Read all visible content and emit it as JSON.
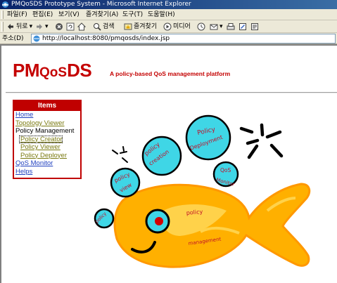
{
  "window": {
    "title": "PMQoSDS Prototype System - Microsoft Internet Explorer"
  },
  "menu": [
    "파일(F)",
    "편집(E)",
    "보기(V)",
    "즐겨찾기(A)",
    "도구(T)",
    "도움말(H)"
  ],
  "toolbar": {
    "back": "뒤로",
    "search": "검색",
    "favorites": "즐겨찾기",
    "media": "미디어"
  },
  "address": {
    "label": "주소(D)",
    "url": "http://localhost:8080/pmqosds/index.jsp"
  },
  "header": {
    "logo_pm": "PM",
    "logo_qos": "QoS",
    "logo_ds": "DS",
    "tagline": "A policy-based QoS management platform"
  },
  "items": {
    "title": "Items",
    "home": "Home",
    "topology_viewer": "Topology Viewer",
    "policy_management": "Policy Management",
    "policy_creator": "Policy Creator",
    "policy_viewer": "Policy Viewer",
    "policy_deployer": "Policy Deployer",
    "qos_monitor": "QoS Monitor",
    "helps": "Helps"
  },
  "drawing": {
    "bubbles": {
      "policy_deployment": [
        "Policy",
        "Deployment"
      ],
      "policy_creation": [
        "policy",
        "creation"
      ],
      "qos_monitor": [
        "QoS",
        "Monitor"
      ],
      "policy_view": [
        "policy",
        "view"
      ],
      "policy_small": "policy"
    },
    "fish_text": [
      "policy",
      "management"
    ],
    "colors": {
      "bubble": "#3fd6e6",
      "fish": "#ffb000",
      "fish_light": "#ffd24a",
      "ink": "#000000",
      "red": "#d40000"
    }
  }
}
